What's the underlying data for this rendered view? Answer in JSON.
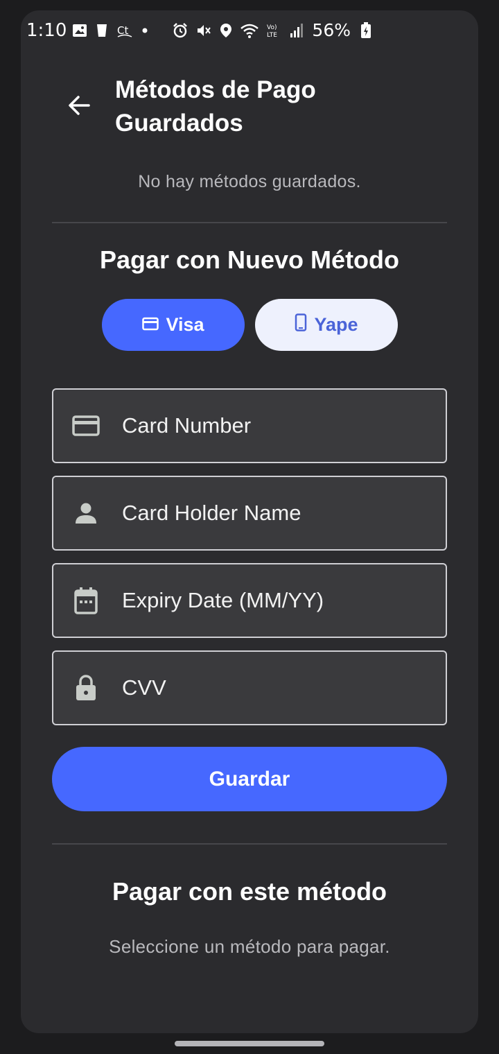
{
  "status_bar": {
    "time": "1:10",
    "battery": "56%"
  },
  "header": {
    "title": "Métodos de Pago Guardados"
  },
  "saved_methods": {
    "empty_text": "No hay métodos guardados."
  },
  "new_method": {
    "title": "Pagar con Nuevo Método",
    "tabs": [
      {
        "label": "Visa",
        "icon": "credit-card-icon",
        "selected": true
      },
      {
        "label": "Yape",
        "icon": "phone-icon",
        "selected": false
      }
    ],
    "fields": {
      "card_number": {
        "placeholder": "Card Number",
        "icon": "credit-card-icon"
      },
      "card_holder": {
        "placeholder": "Card Holder Name",
        "icon": "person-icon"
      },
      "expiry": {
        "placeholder": "Expiry Date (MM/YY)",
        "icon": "calendar-icon"
      },
      "cvv": {
        "placeholder": "CVV",
        "icon": "lock-icon"
      }
    },
    "save_label": "Guardar"
  },
  "pay_section": {
    "title": "Pagar con este método",
    "hint": "Seleccione un método para pagar."
  },
  "colors": {
    "accent": "#4668ff",
    "background": "#2b2b2e",
    "field_background": "#3a3a3d"
  }
}
